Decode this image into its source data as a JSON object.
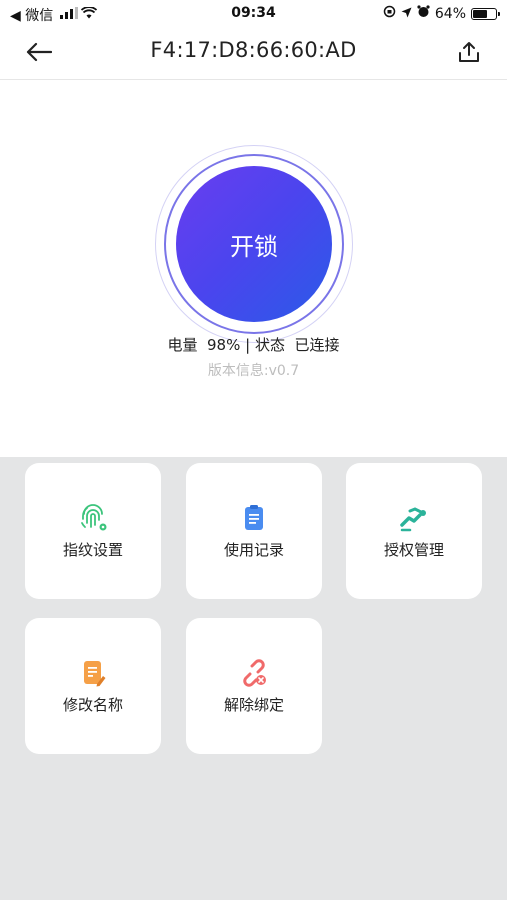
{
  "status_bar": {
    "back_app": "◀ 微信",
    "time": "09:34",
    "battery": "64%",
    "battery_level": 0.64
  },
  "nav": {
    "title": "F4:17:D8:66:60:AD"
  },
  "lock": {
    "button_label": "开锁",
    "battery_label": "电量",
    "battery_value": "98%",
    "separator": "|",
    "status_label": "状态",
    "status_value": "已连接",
    "version": "版本信息:v0.7"
  },
  "actions": [
    {
      "label": "指纹设置",
      "icon": "fingerprint-icon",
      "color": "#3cc47c"
    },
    {
      "label": "使用记录",
      "icon": "clipboard-icon",
      "color": "#4a8cf0"
    },
    {
      "label": "授权管理",
      "icon": "handshake-icon",
      "color": "#2bb39a"
    },
    {
      "label": "修改名称",
      "icon": "edit-document-icon",
      "color": "#f5a047"
    },
    {
      "label": "解除绑定",
      "icon": "unlink-icon",
      "color": "#f06a6a"
    }
  ]
}
